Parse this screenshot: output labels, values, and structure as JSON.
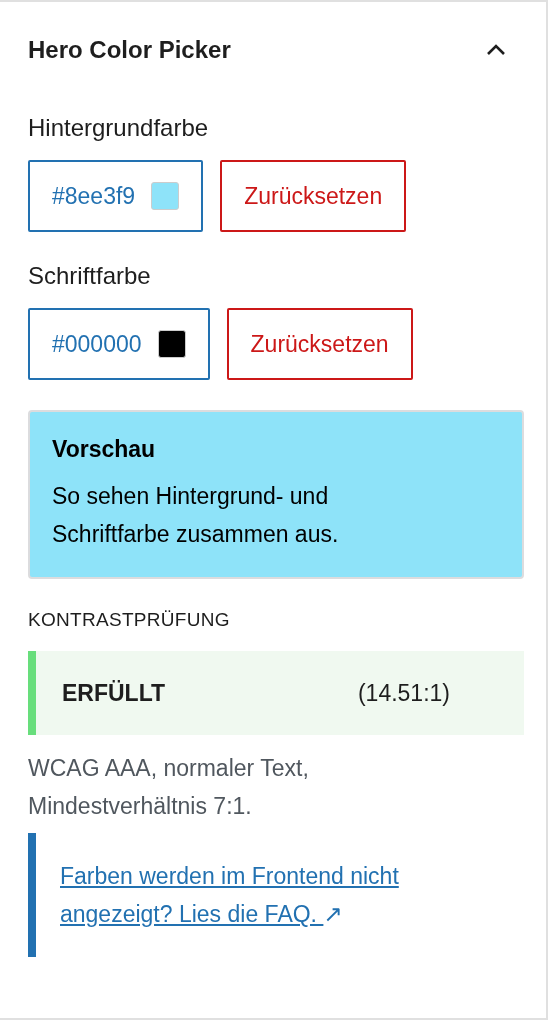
{
  "panel": {
    "title": "Hero Color Picker",
    "expanded": true
  },
  "color_settings": [
    {
      "label": "Hintergrundfarbe",
      "value": "#8ee3f9",
      "color": "#8ee3f9",
      "reset_label": "Zurücksetzen"
    },
    {
      "label": "Schriftfarbe",
      "value": "#000000",
      "color": "#000000",
      "reset_label": "Zurücksetzen"
    }
  ],
  "preview": {
    "title": "Vorschau",
    "text": "So sehen Hintergrund- und Schriftfarbe zusammen aus."
  },
  "contrast_check": {
    "heading": "KONTRASTPRÜFUNG",
    "passed": true,
    "result": "ERFÜLLT",
    "ratio": "(14.51:1)",
    "note": "WCAG AAA, normaler Text, Mindestverhältnis 7:1."
  },
  "help": {
    "link": "Farben werden im Frontend nicht angezeigt? Lies die FAQ.",
    "link_icon": "↗"
  }
}
